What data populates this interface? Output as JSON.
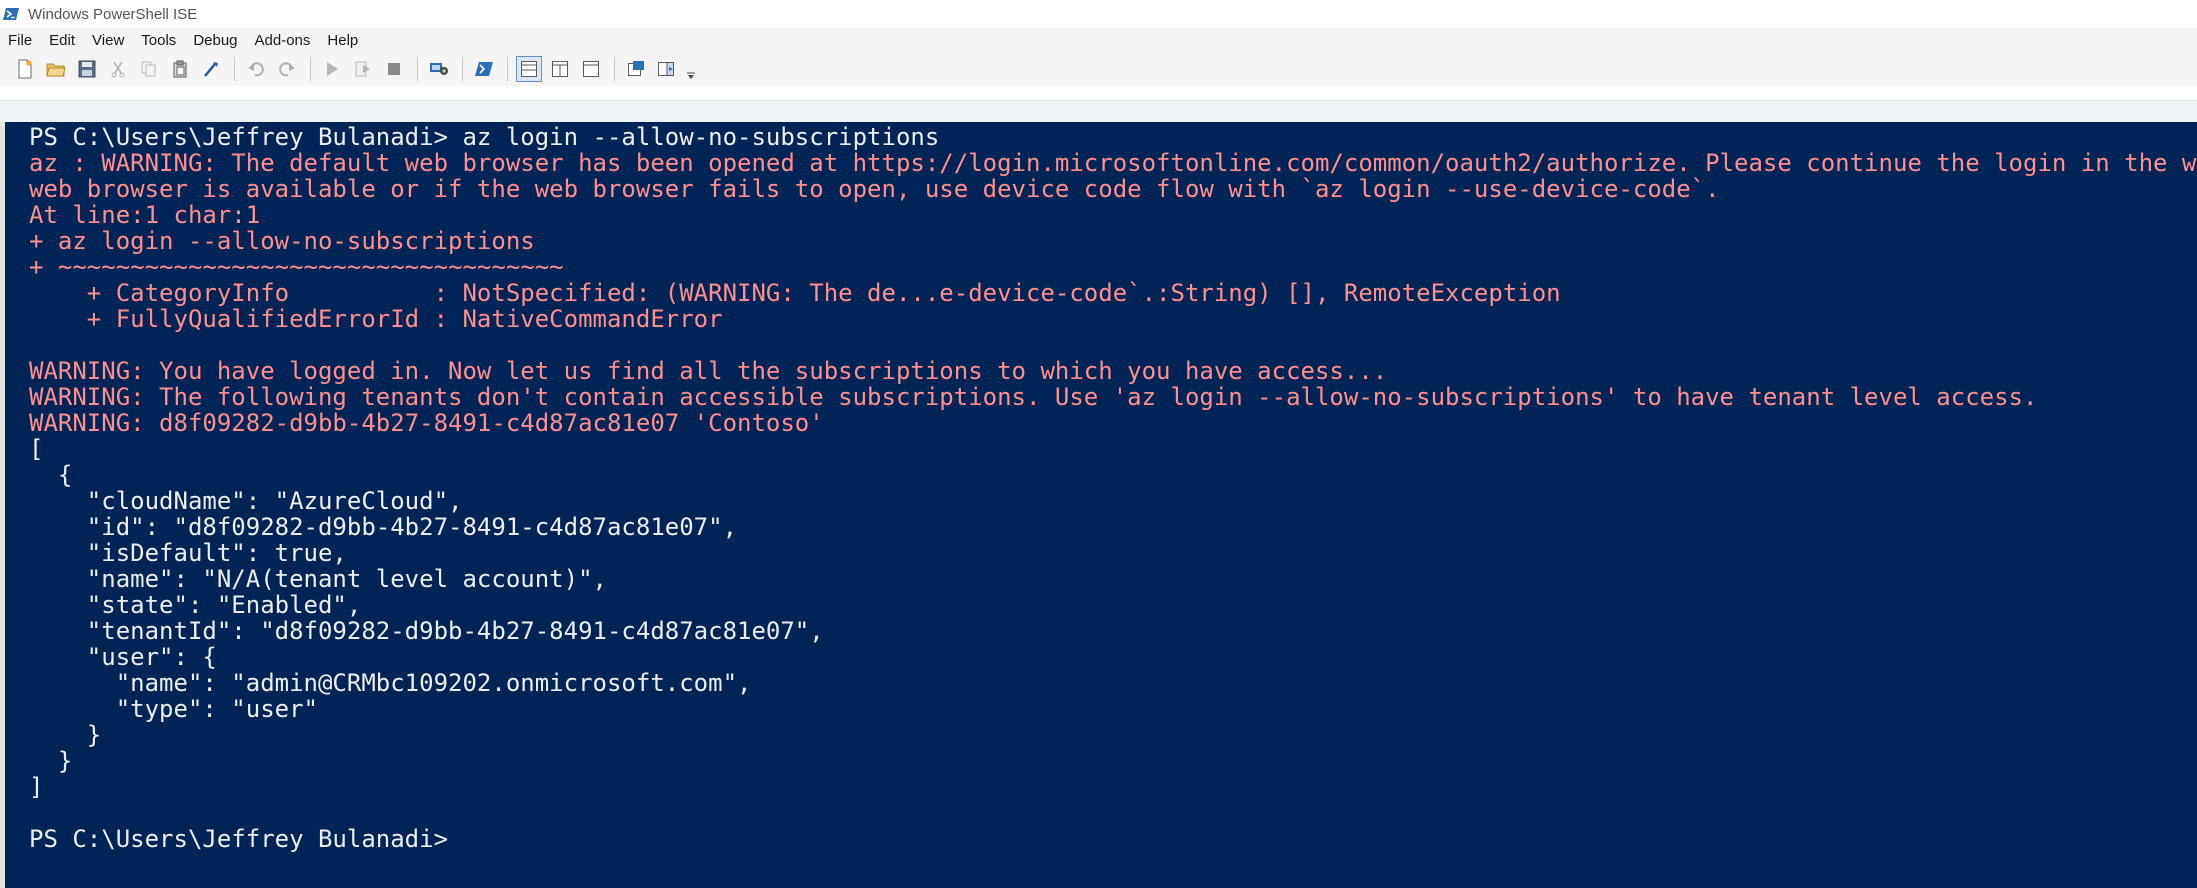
{
  "window": {
    "title": "Windows PowerShell ISE",
    "icon": "powershell-icon"
  },
  "menu": {
    "items": [
      "File",
      "Edit",
      "View",
      "Tools",
      "Debug",
      "Add-ons",
      "Help"
    ]
  },
  "toolbar": {
    "buttons": [
      "new-file-icon",
      "open-file-icon",
      "save-icon",
      "cut-icon",
      "copy-icon",
      "paste-icon",
      "clear-icon",
      "undo-icon",
      "redo-icon",
      "run-script-icon",
      "run-selection-icon",
      "stop-icon",
      "remote-tab-icon",
      "powershell-console-icon",
      "show-script-top-icon",
      "show-script-right-icon",
      "show-script-max-icon",
      "show-command-icon",
      "show-addon-icon",
      "more-icon"
    ]
  },
  "colors": {
    "console_bg": "#012456",
    "console_text": "#eeedf0",
    "error_text": "#ff8e8e"
  },
  "console": {
    "lines": [
      {
        "text": "PS C:\\Users\\Jeffrey Bulanadi> az login --allow-no-subscriptions",
        "kind": "normal"
      },
      {
        "text": "az : WARNING: The default web browser has been opened at https://login.microsoftonline.com/common/oauth2/authorize. Please continue the login in the w",
        "kind": "error"
      },
      {
        "text": "web browser is available or if the web browser fails to open, use device code flow with `az login --use-device-code`.",
        "kind": "error"
      },
      {
        "text": "At line:1 char:1",
        "kind": "error"
      },
      {
        "text": "+ az login --allow-no-subscriptions",
        "kind": "error"
      },
      {
        "text": "+ ~~~~~~~~~~~~~~~~~~~~~~~~~~~~~~~~~~~",
        "kind": "error"
      },
      {
        "text": "    + CategoryInfo          : NotSpecified: (WARNING: The de...e-device-code`.:String) [], RemoteException",
        "kind": "error"
      },
      {
        "text": "    + FullyQualifiedErrorId : NativeCommandError",
        "kind": "error"
      },
      {
        "text": "",
        "kind": "normal"
      },
      {
        "text": "WARNING: You have logged in. Now let us find all the subscriptions to which you have access...",
        "kind": "warn"
      },
      {
        "text": "WARNING: The following tenants don't contain accessible subscriptions. Use 'az login --allow-no-subscriptions' to have tenant level access.",
        "kind": "warn"
      },
      {
        "text": "WARNING: d8f09282-d9bb-4b27-8491-c4d87ac81e07 'Contoso'",
        "kind": "warn"
      },
      {
        "text": "[",
        "kind": "normal"
      },
      {
        "text": "  {",
        "kind": "normal"
      },
      {
        "text": "    \"cloudName\": \"AzureCloud\",",
        "kind": "normal"
      },
      {
        "text": "    \"id\": \"d8f09282-d9bb-4b27-8491-c4d87ac81e07\",",
        "kind": "normal"
      },
      {
        "text": "    \"isDefault\": true,",
        "kind": "normal"
      },
      {
        "text": "    \"name\": \"N/A(tenant level account)\",",
        "kind": "normal"
      },
      {
        "text": "    \"state\": \"Enabled\",",
        "kind": "normal"
      },
      {
        "text": "    \"tenantId\": \"d8f09282-d9bb-4b27-8491-c4d87ac81e07\",",
        "kind": "normal"
      },
      {
        "text": "    \"user\": {",
        "kind": "normal"
      },
      {
        "text": "      \"name\": \"admin@CRMbc109202.onmicrosoft.com\",",
        "kind": "normal"
      },
      {
        "text": "      \"type\": \"user\"",
        "kind": "normal"
      },
      {
        "text": "    }",
        "kind": "normal"
      },
      {
        "text": "  }",
        "kind": "normal"
      },
      {
        "text": "]",
        "kind": "normal"
      },
      {
        "text": "",
        "kind": "normal"
      },
      {
        "text": "PS C:\\Users\\Jeffrey Bulanadi>",
        "kind": "normal"
      }
    ]
  }
}
